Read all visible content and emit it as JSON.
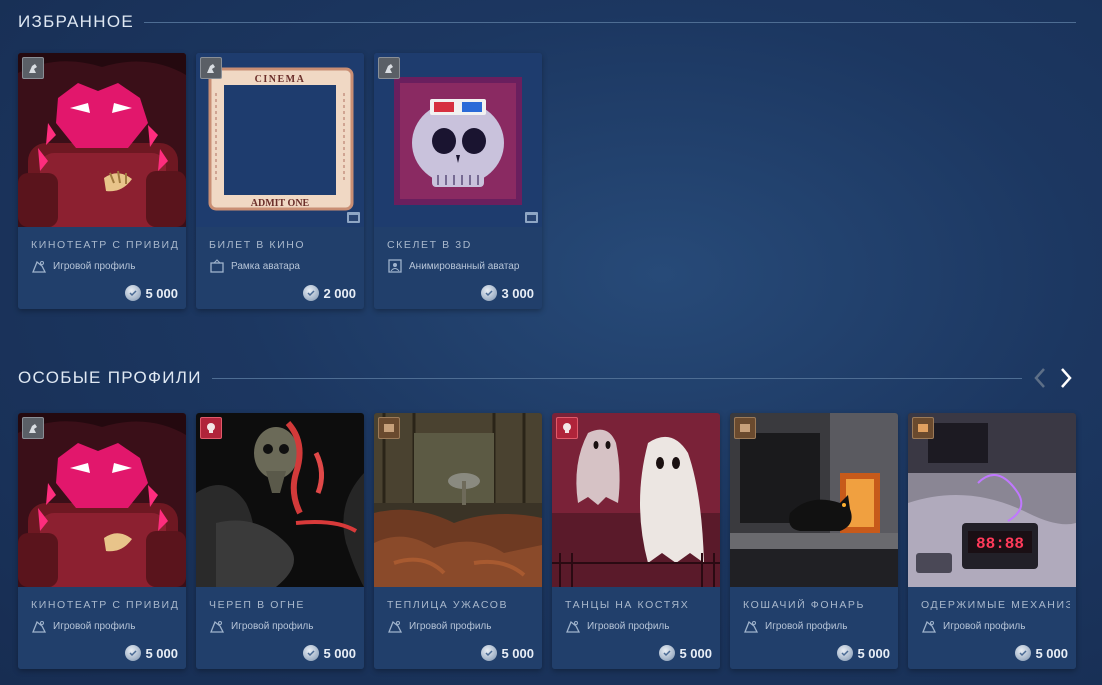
{
  "sections": {
    "favorites": {
      "title": "ИЗБРАННОЕ",
      "items": [
        {
          "name": "КИНОТЕАТР С ПРИВИДЕНИЯМИ",
          "type": "Игровой профиль",
          "price": "5 000",
          "art": "cinema-ghost-profile"
        },
        {
          "name": "БИЛЕТ В КИНО",
          "type": "Рамка аватара",
          "price": "2 000",
          "art": "cinema-ticket-frame"
        },
        {
          "name": "СКЕЛЕТ В 3D",
          "type": "Анимированный аватар",
          "price": "3 000",
          "art": "3d-skull-avatar"
        }
      ]
    },
    "special_profiles": {
      "title": "ОСОБЫЕ ПРОФИЛИ",
      "items": [
        {
          "name": "КИНОТЕАТР С ПРИВИДЕНИЯМИ",
          "type": "Игровой профиль",
          "price": "5 000",
          "art": "cinema-ghost-profile"
        },
        {
          "name": "ЧЕРЕП В ОГНЕ",
          "type": "Игровой профиль",
          "price": "5 000",
          "art": "flaming-skull-profile"
        },
        {
          "name": "ТЕПЛИЦА УЖАСОВ",
          "type": "Игровой профиль",
          "price": "5 000",
          "art": "greenhouse-horror-profile"
        },
        {
          "name": "ТАНЦЫ НА КОСТЯХ",
          "type": "Игровой профиль",
          "price": "5 000",
          "art": "dancing-ghosts-profile"
        },
        {
          "name": "КОШАЧИЙ ФОНАРЬ",
          "type": "Игровой профиль",
          "price": "5 000",
          "art": "cat-lantern-profile"
        },
        {
          "name": "ОДЕРЖИМЫЕ МЕХАНИЗМЫ",
          "type": "Игровой профиль",
          "price": "5 000",
          "art": "haunted-machines-profile"
        }
      ]
    }
  },
  "colors": {
    "background": "#1c3761",
    "card": "#213f6c",
    "accent": "#e8eef6"
  }
}
